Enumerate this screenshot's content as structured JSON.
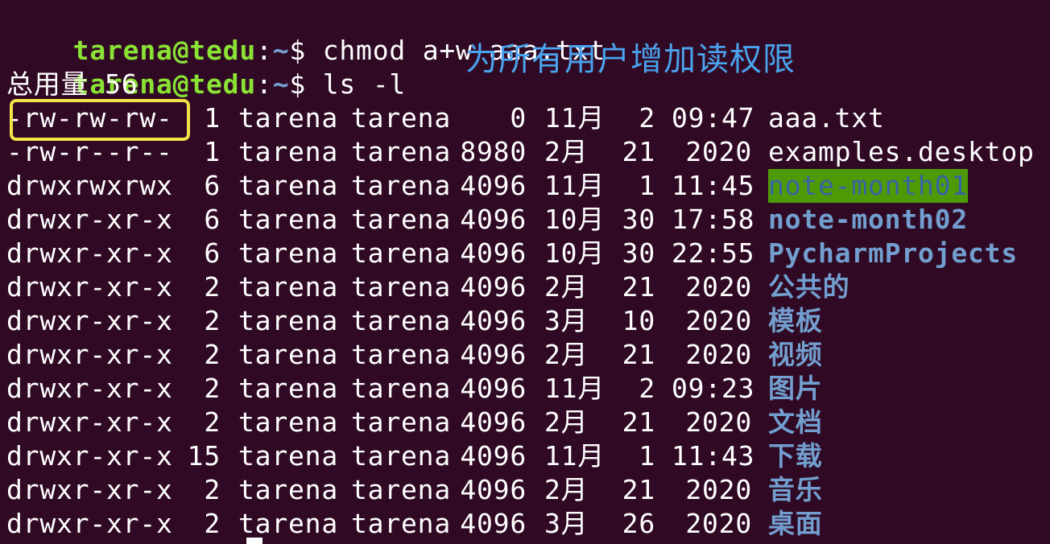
{
  "prompt": {
    "user_host": "tarena@tedu",
    "sep": ":",
    "path": "~",
    "symbol": "$"
  },
  "commands": [
    " chmod a+w aaa.txt",
    " ls -l"
  ],
  "annotation": "为所有用户增加读权限",
  "total_line": "总用量 56",
  "listing": [
    {
      "perms": "-rw-rw-rw-",
      "links": "1",
      "owner": "tarena",
      "group": "tarena",
      "size": "0",
      "month": "11月",
      "day": "2",
      "time": "09:47",
      "name": "aaa.txt",
      "type": "file"
    },
    {
      "perms": "-rw-r--r--",
      "links": "1",
      "owner": "tarena",
      "group": "tarena",
      "size": "8980",
      "month": "2月",
      "day": "21",
      "time": "2020",
      "name": "examples.desktop",
      "type": "file"
    },
    {
      "perms": "drwxrwxrwx",
      "links": "6",
      "owner": "tarena",
      "group": "tarena",
      "size": "4096",
      "month": "11月",
      "day": "1",
      "time": "11:45",
      "name": "note-month01",
      "type": "dir-other-writable"
    },
    {
      "perms": "drwxr-xr-x",
      "links": "6",
      "owner": "tarena",
      "group": "tarena",
      "size": "4096",
      "month": "10月",
      "day": "30",
      "time": "17:58",
      "name": "note-month02",
      "type": "dir"
    },
    {
      "perms": "drwxr-xr-x",
      "links": "6",
      "owner": "tarena",
      "group": "tarena",
      "size": "4096",
      "month": "10月",
      "day": "30",
      "time": "22:55",
      "name": "PycharmProjects",
      "type": "dir"
    },
    {
      "perms": "drwxr-xr-x",
      "links": "2",
      "owner": "tarena",
      "group": "tarena",
      "size": "4096",
      "month": "2月",
      "day": "21",
      "time": "2020",
      "name": "公共的",
      "type": "dir"
    },
    {
      "perms": "drwxr-xr-x",
      "links": "2",
      "owner": "tarena",
      "group": "tarena",
      "size": "4096",
      "month": "3月",
      "day": "10",
      "time": "2020",
      "name": "模板",
      "type": "dir"
    },
    {
      "perms": "drwxr-xr-x",
      "links": "2",
      "owner": "tarena",
      "group": "tarena",
      "size": "4096",
      "month": "2月",
      "day": "21",
      "time": "2020",
      "name": "视频",
      "type": "dir"
    },
    {
      "perms": "drwxr-xr-x",
      "links": "2",
      "owner": "tarena",
      "group": "tarena",
      "size": "4096",
      "month": "11月",
      "day": "2",
      "time": "09:23",
      "name": "图片",
      "type": "dir"
    },
    {
      "perms": "drwxr-xr-x",
      "links": "2",
      "owner": "tarena",
      "group": "tarena",
      "size": "4096",
      "month": "2月",
      "day": "21",
      "time": "2020",
      "name": "文档",
      "type": "dir"
    },
    {
      "perms": "drwxr-xr-x",
      "links": "15",
      "owner": "tarena",
      "group": "tarena",
      "size": "4096",
      "month": "11月",
      "day": "1",
      "time": "11:43",
      "name": "下载",
      "type": "dir"
    },
    {
      "perms": "drwxr-xr-x",
      "links": "2",
      "owner": "tarena",
      "group": "tarena",
      "size": "4096",
      "month": "2月",
      "day": "21",
      "time": "2020",
      "name": "音乐",
      "type": "dir"
    },
    {
      "perms": "drwxr-xr-x",
      "links": "2",
      "owner": "tarena",
      "group": "tarena",
      "size": "4096",
      "month": "3月",
      "day": "26",
      "time": "2020",
      "name": "桌面",
      "type": "dir"
    }
  ],
  "colors": {
    "background": "#300a24",
    "prompt_user": "#8ae234",
    "prompt_path": "#729fcf",
    "directory": "#729fcf",
    "annotation": "#4aa3ee",
    "highlight_box": "#f2e34a",
    "other_writable_bg": "#4e9a06"
  }
}
